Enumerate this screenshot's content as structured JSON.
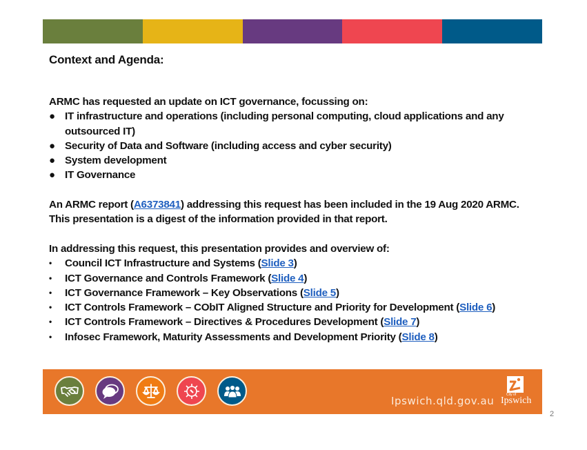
{
  "colorbar": {
    "segments": [
      "#6a7f3d",
      "#e6b417",
      "#673a80",
      "#ef4650",
      "#005a89"
    ]
  },
  "title": "Context and Agenda:",
  "intro": {
    "lead": "ARMC has requested an update on ICT governance, focussing on:",
    "bullets": [
      "IT infrastructure and operations (including personal computing, cloud applications and any outsourced IT)",
      "Security of Data and Software (including access and cyber security)",
      "System development",
      "IT Governance"
    ]
  },
  "report": {
    "prefix": "An ARMC report (",
    "link": "A6373841",
    "suffix": ") addressing this request has been included in the 19 Aug 2020 ARMC.   This presentation is a digest of the information provided in that report."
  },
  "overview": {
    "lead": "In addressing this request, this presentation provides and overview of:",
    "items": [
      {
        "text": "Council ICT Infrastructure and Systems (",
        "link": "Slide 3",
        "close": ")"
      },
      {
        "text": "ICT Governance and Controls Framework (",
        "link": "Slide 4",
        "close": ")"
      },
      {
        "text": "ICT Governance Framework – Key Observations (",
        "link": "Slide 5",
        "close": ")"
      },
      {
        "text": "ICT Controls Framework – CObIT Aligned Structure and Priority for Development (",
        "link": "Slide 6",
        "close": ")"
      },
      {
        "text": "ICT Controls Framework – Directives & Procedures Development (",
        "link": "Slide 7",
        "close": ")"
      },
      {
        "text": "Infosec Framework, Maturity Assessments and Development Priority (",
        "link": "Slide 8",
        "close": ")"
      }
    ]
  },
  "bullets": {
    "big": "●",
    "small": "•"
  },
  "footer": {
    "bg": "#e8772a",
    "icons": [
      {
        "name": "handshake-icon",
        "color": "#6a7f3d"
      },
      {
        "name": "speech-bubbles-icon",
        "color": "#673a80"
      },
      {
        "name": "scales-icon",
        "color": "#f07c14"
      },
      {
        "name": "gear-icon",
        "color": "#ef4650"
      },
      {
        "name": "people-icon",
        "color": "#005a89"
      }
    ],
    "website": "Ipswich.qld.gov.au",
    "logo": {
      "city_of": "City of",
      "name": "Ipswich"
    }
  },
  "page_number": "2"
}
